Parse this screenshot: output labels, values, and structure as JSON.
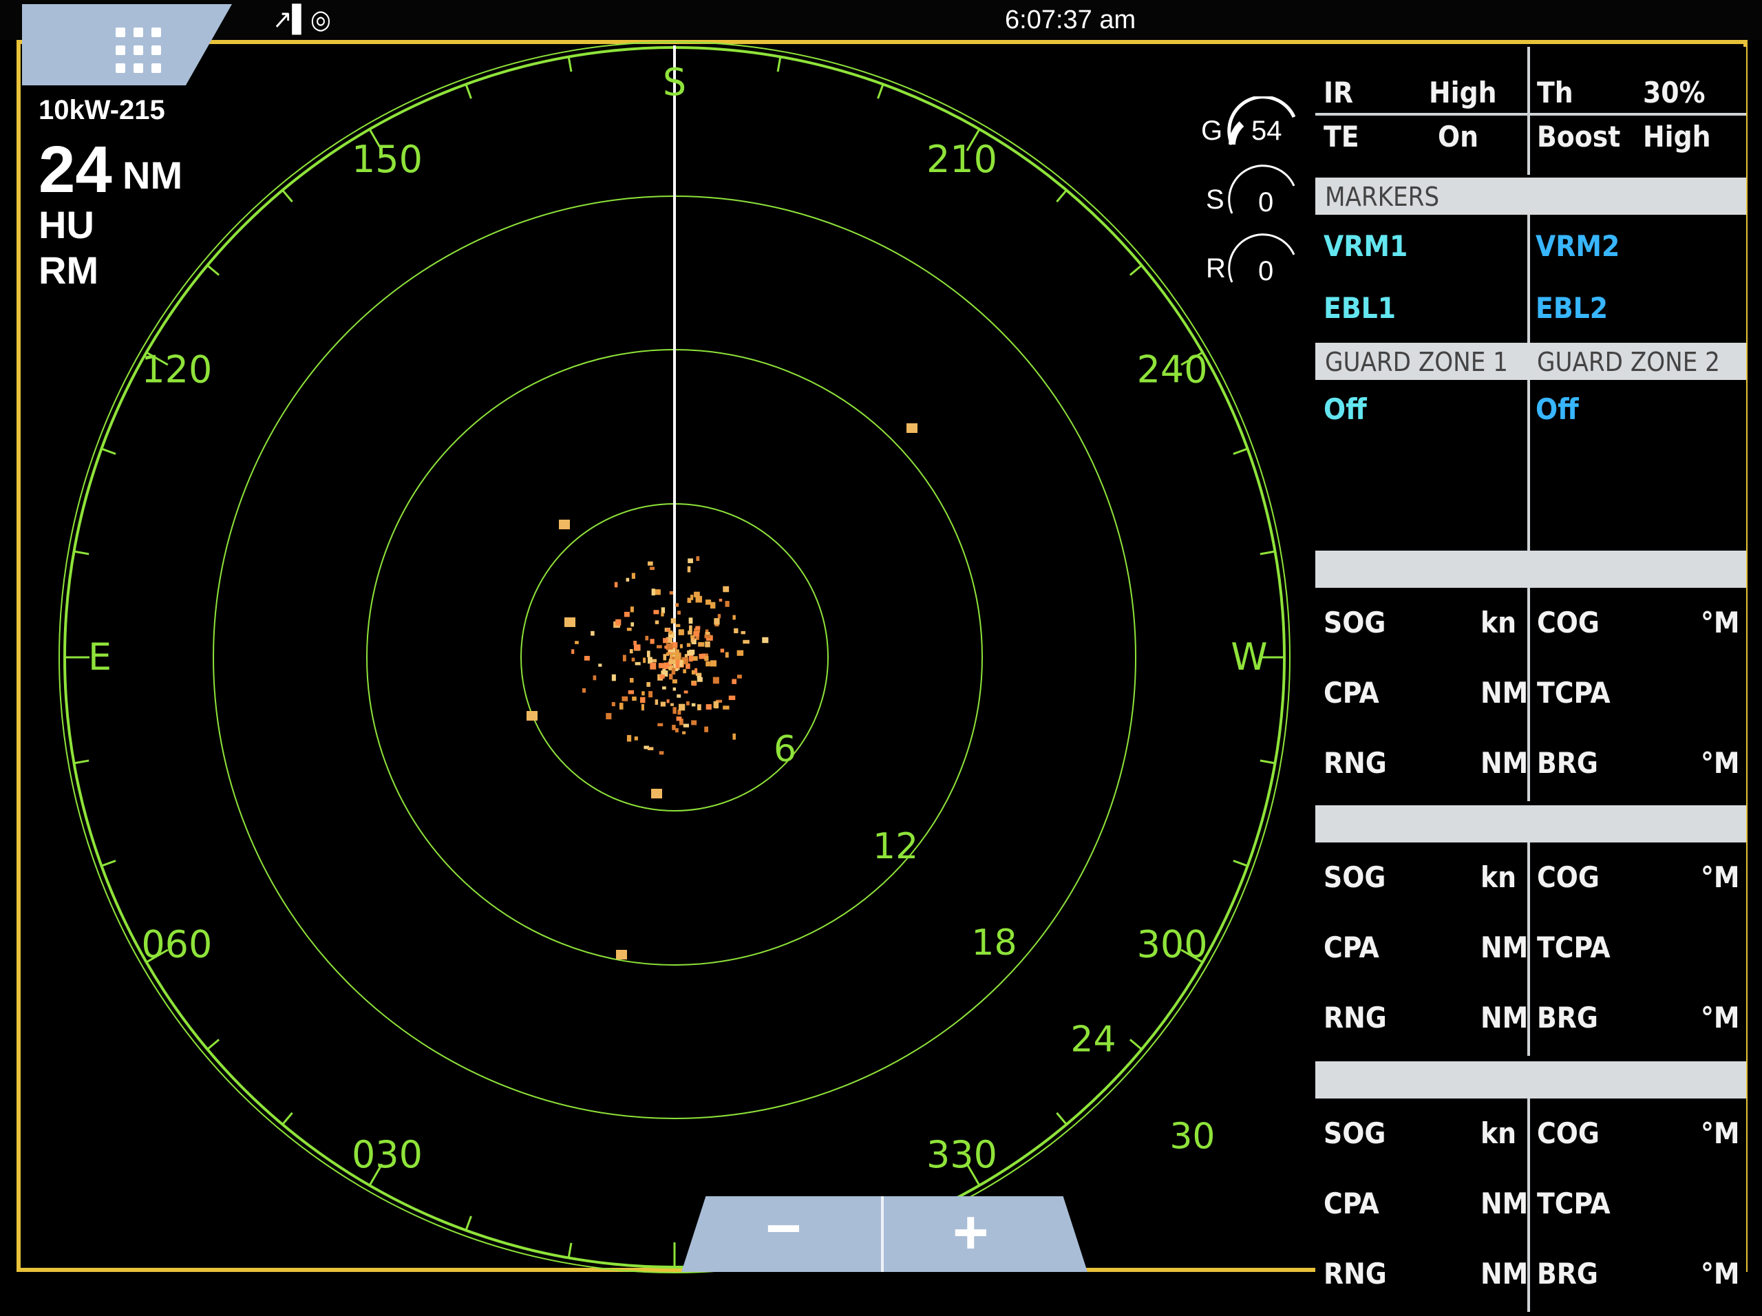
{
  "status_bar": {
    "clock": "6:07:37 am",
    "status_glyph": "↗▌◎"
  },
  "radar_info": {
    "model": "10kW-215",
    "range_value": "24",
    "range_unit": "NM",
    "orientation": "HU",
    "motion": "RM"
  },
  "compass_labels": [
    {
      "text": "S",
      "angle": 180
    },
    {
      "text": "210",
      "angle": 210
    },
    {
      "text": "240",
      "angle": 240
    },
    {
      "text": "W",
      "angle": 270
    },
    {
      "text": "300",
      "angle": 300
    },
    {
      "text": "330",
      "angle": 330
    },
    {
      "text": "030",
      "angle": 30
    },
    {
      "text": "060",
      "angle": 60
    },
    {
      "text": "E",
      "angle": 90
    },
    {
      "text": "120",
      "angle": 120
    },
    {
      "text": "150",
      "angle": 150
    }
  ],
  "range_rings": [
    "6",
    "12",
    "18",
    "24",
    "30"
  ],
  "gauges": [
    {
      "label": "G",
      "value": "54"
    },
    {
      "label": "S",
      "value": "0"
    },
    {
      "label": "R",
      "value": "0"
    }
  ],
  "settings": {
    "ir_label": "IR",
    "ir_value": "High",
    "th_label": "Th",
    "th_value": "30%",
    "te_label": "TE",
    "te_value": "On",
    "boost_label": "Boost",
    "boost_value": "High"
  },
  "markers": {
    "header": "MARKERS",
    "vrm1": "VRM1",
    "vrm2": "VRM2",
    "ebl1": "EBL1",
    "ebl2": "EBL2"
  },
  "guard_zones": {
    "zone1_label": "GUARD ZONE 1",
    "zone2_label": "GUARD ZONE 2",
    "zone1_value": "Off",
    "zone2_value": "Off"
  },
  "targets": [
    {
      "sog": "SOG",
      "sog_unit": "kn",
      "cog": "COG",
      "cog_unit": "°M",
      "cpa": "CPA",
      "cpa_unit": "NM",
      "tcpa": "TCPA",
      "rng": "RNG",
      "rng_unit": "NM",
      "brg": "BRG",
      "brg_unit": "°M"
    },
    {
      "sog": "SOG",
      "sog_unit": "kn",
      "cog": "COG",
      "cog_unit": "°M",
      "cpa": "CPA",
      "cpa_unit": "NM",
      "tcpa": "TCPA",
      "rng": "RNG",
      "rng_unit": "NM",
      "brg": "BRG",
      "brg_unit": "°M"
    },
    {
      "sog": "SOG",
      "sog_unit": "kn",
      "cog": "COG",
      "cog_unit": "°M",
      "cpa": "CPA",
      "cpa_unit": "NM",
      "tcpa": "TCPA",
      "rng": "RNG",
      "rng_unit": "NM",
      "brg": "BRG",
      "brg_unit": "°M"
    }
  ],
  "zoom": {
    "minus": "−",
    "plus": "+"
  },
  "colors": {
    "radar_green": "#8fe33a",
    "frame_yellow": "#e8c23a",
    "panel_cyan": "#63e6f0",
    "panel_blue": "#38b6ff"
  }
}
